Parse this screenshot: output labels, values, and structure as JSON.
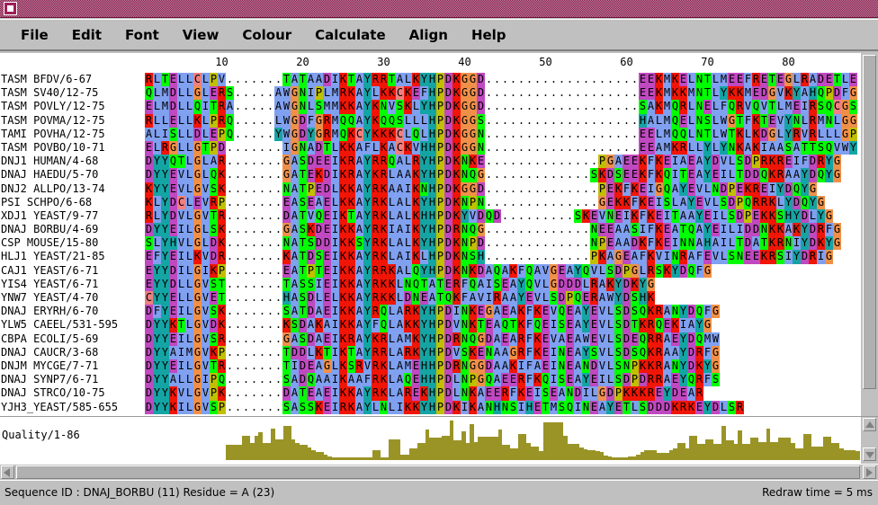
{
  "window": {
    "title": "",
    "title_button_icon": "window-menu-icon"
  },
  "menubar": {
    "items": [
      {
        "label": "File"
      },
      {
        "label": "Edit"
      },
      {
        "label": "Font"
      },
      {
        "label": "View"
      },
      {
        "label": "Colour"
      },
      {
        "label": "Calculate"
      },
      {
        "label": "Align"
      },
      {
        "label": "Help"
      }
    ]
  },
  "ruler": {
    "ticks": [
      10,
      20,
      30,
      40,
      50,
      60,
      70,
      80
    ]
  },
  "colours": {
    "A": "#80a0f0",
    "R": "#f01505",
    "N": "#00ff00",
    "D": "#c048c0",
    "C": "#f08080",
    "Q": "#00ff00",
    "E": "#c048c0",
    "G": "#f09048",
    "H": "#15a4a4",
    "I": "#80a0f0",
    "L": "#80a0f0",
    "K": "#f01505",
    "M": "#80a0f0",
    "F": "#80a0f0",
    "P": "#c0c000",
    "S": "#00ff00",
    "T": "#00ff00",
    "W": "#80a0f0",
    "Y": "#15a4a4",
    "V": "#80a0f0",
    "B": "#ffffff",
    "Z": "#ffffff",
    "X": "#ffffff",
    "-": "#ffffff",
    ".": "#ffffff",
    "gap": "#ffffff",
    "quality_bar": "#9a9427",
    "titlebar": "#8d1b4d",
    "chrome": "#c0c0c0"
  },
  "alignment": {
    "id_label_width_chars": 20,
    "sequences": [
      {
        "id": "TASM BFDV/6-67",
        "seq": "RLTELLCLPV.......TATAADIKTAYRRTALKYHPDKGGD...................EEKMKELNTLMEEFRETEGLRADETLE"
      },
      {
        "id": "TASM SV40/12-75",
        "seq": "QLMDLLGLERS.....AWGNIPLMRKAYLKKCKEFHPDKGGD...................EEKMKKMNTLYKKMEDGVKYAHQPDFG"
      },
      {
        "id": "TASM POVLY/12-75",
        "seq": "ELMDLLQITRA.....AWGNLSMMKKAYKNVSKLYHPDKGGD...................SAKMQRLNELFQRVQVTLMEIRSQCGS"
      },
      {
        "id": "TASM POVMA/12-75",
        "seq": "RLLELLKLPRQ.....LWGDFGRMQQAYKQQSLLLHPDKGGS...................HALMQELNSLWGTFKTEVYNLRMNLGG"
      },
      {
        "id": "TAMI POVHA/12-75",
        "seq": "ALISLLDLEPQ.....YWGDYGRMQKCYKKKCLQLHPDKGGN...................EELMQQLNTLWTKLKDGLYRVRLLLGP"
      },
      {
        "id": "TASM POVBO/10-71",
        "seq": "ELRGLLGTPD.......IGNADTLKKAFLKACKVHHPDKGGN...................EEAMKRLLYLYNKAKIAASATTSQVWY"
      },
      {
        "id": "DNJ1 HUMAN/4-68",
        "seq": "DYYQTLGLAR.......GASDEEIKRAYRRQALRYHPDKNKE..............PGAEEKFKEIAEAYDVLSDPRKREIFDRYG"
      },
      {
        "id": "DNAJ HAEDU/5-70",
        "seq": "DYYEVLGLQK.......GATEKDIKRAYKRLAAKYHPDKNQG.............SKDSEEKFKQITEAYEILTDDQKRAAYDQYG"
      },
      {
        "id": "DNJ2 ALLPO/13-74",
        "seq": "KYYEVLGVSK.......NATPEDLKKAYRKAAIKNHPDKGGD..............PEKFKEIGQAYEVLNDPEKREIYDQYG"
      },
      {
        "id": "PSI SCHPO/6-68",
        "seq": "KLYDCLEVRP.......EASEAELKKAYRKLALKYHPDKNPN..............GEKKFKEISLAYEVLSDPQRRKLYDQYG"
      },
      {
        "id": "XDJ1 YEAST/9-77",
        "seq": "RLYDVLGVTR.......DATVQEIKTAYRKLALKHHPDKYVDQD.........SKEVNEIKFKEITAAYEILSDPEKKSHYDLYG"
      },
      {
        "id": "DNAJ BORBU/4-69",
        "seq": "DYYEILGLSK.......GASKDEIKKAYRKIAIKYHPDRNQG.............NEEAASIFKEATQAYEILIDDNKKAKYDRFG"
      },
      {
        "id": "CSP MOUSE/15-80",
        "seq": "SLYHVLGLDK.......NATSDDIKKSYRKLALKYHPDKNPD.............NPEAADKFKEINNAHAILTDATKRNIYDKYG"
      },
      {
        "id": "HLJ1 YEAST/21-85",
        "seq": "EFYEILKVDR.......KATDSEIKKAYRKLAIKLHPDKNSH.............PKAGEAFKVINRAFEVLSNEEKRSIYDRIG"
      },
      {
        "id": "CAJ1 YEAST/6-71",
        "seq": "EYYDILGIKP.......EATPTEIKKAYRRKALQYHPDKNKDAQAKFQAVGEAYQVLSDPGLRSKYDQFG"
      },
      {
        "id": "YIS4 YEAST/6-71",
        "seq": "EYYDLLGVST.......TASSIEIKKAYRKKLNQTATERFQAISEAYQVLGDDDLRAKYDKYG"
      },
      {
        "id": "YNW7 YEAST/4-70",
        "seq": "CYYELLGVET.......HASDLELKKAYRKKLDNEATQKFAVIRAAYEVLSDPQERAWYDSHK"
      },
      {
        "id": "DNAJ ERYRH/6-70",
        "seq": "DFYEILGVSK.......SATDAEIKKAYRQLARKYHPDINKEGAEAKFKEVQEAYEVLSDSQKRANYDQFG"
      },
      {
        "id": "YLW5 CAEEL/531-595",
        "seq": "DYYKTLGVDK.......KSDAKAIKKAYFQLAKKYHPDVNKTEAQTKFQEISEAYEVLSDTKRQEKIAYG"
      },
      {
        "id": "CBPA ECOLI/5-69",
        "seq": "DYYEILGVSR.......GASDAEIKRAYKRLAMKYHPDRNQGDAEARFKEVAEAWEVLSDEQRRAEYDQMW"
      },
      {
        "id": "DNAJ CAUCR/3-68",
        "seq": "DYYAIMGVKP.......TDDLKTIKTAYRRLARKYHPDVSKENAAGRFKEINEAYSVLSDSQKRAAYDRFG"
      },
      {
        "id": "DNJM MYCGE/7-71",
        "seq": "DYYEILGVTR.......TIDEAGLKSRVRKLAMEHHPDRNGGDAAKIFAEINEANDVLSNPKKRANYDKYG"
      },
      {
        "id": "DNAJ SYNP7/6-71",
        "seq": "DYYALLGIPQ.......SADQAAIKAAFRKLAQEHHPDLNPGQAEERFKQISEAYEILSDPDRRAEYQRFS"
      },
      {
        "id": "DNAJ STRCO/10-75",
        "seq": "DYYKVLGVPK.......DATEAEIKKAYRKLAREKHPDLNKAEERFKEISEANDILGDPKKKREYDEAR"
      },
      {
        "id": "YJH3_YEAST/585-655",
        "seq": "DYYKILGVSP.......SASSKEIRKAYLNLIKKYHPDKIKANHNSIHETMSQINEAYETLSDDDKRKEYDLSR"
      }
    ]
  },
  "annotation": {
    "label": "Quality/1-86",
    "bar_color": "#9a9427",
    "values": [
      0,
      0,
      0,
      0,
      0,
      0,
      0,
      0,
      0,
      0,
      0,
      0,
      0,
      0,
      0,
      0,
      0,
      0,
      0,
      0,
      0.38,
      0.38,
      0.38,
      0.38,
      0.62,
      0.62,
      0.44,
      0.62,
      0.7,
      0.44,
      0.44,
      0.8,
      0.52,
      0.52,
      0.86,
      0.86,
      0.52,
      0.44,
      0.38,
      0.38,
      0.32,
      0.26,
      0.2,
      0.2,
      0.14,
      0.1,
      0.07,
      0.07,
      0.07,
      0.07,
      0.07,
      0.07,
      0.07,
      0.07,
      0.07,
      0.07,
      0.24,
      0.24,
      0.07,
      0.07,
      0.52,
      0.52,
      0.52,
      0.14,
      0.14,
      0.3,
      0.3,
      0.44,
      0.44,
      0.78,
      0.56,
      0.56,
      0.56,
      0.62,
      0.62,
      1.0,
      0.5,
      0.5,
      0.72,
      0.44,
      0.9,
      0.46,
      0.6,
      0.6,
      0.6,
      0.6,
      0.6,
      0.78,
      0.38,
      0.38,
      0.3,
      0.3,
      0.66,
      0.66,
      0.44,
      0.34,
      0.34,
      0.22,
      0.95,
      0.95,
      0.95,
      0.95,
      0.95,
      0.62,
      0.4,
      0.4,
      0.4,
      0.32,
      0.28,
      0.26,
      0.24,
      0.22,
      0.2,
      0.12,
      0.08,
      0.06,
      0.06,
      0.06,
      0.06,
      0.08,
      0.1,
      0.14,
      0.2,
      0.24,
      0.24,
      0.24,
      0.18,
      0.18,
      0.18,
      0.24,
      0.3,
      0.44,
      0.44,
      0.3,
      0.62,
      0.62,
      0.4,
      0.4,
      0.52,
      0.52,
      0.4,
      0.4,
      0.86,
      0.5,
      0.5,
      0.4,
      0.76,
      0.42,
      0.42,
      0.56,
      0.56,
      0.46,
      0.46,
      0.8,
      0.46,
      0.46,
      0.56,
      0.56,
      0.56,
      0.44,
      0.3,
      0.3,
      0.66,
      0.66,
      0.34,
      0.34,
      0.34,
      0.58,
      0.58,
      0.44,
      0.44,
      0.3,
      0.24,
      0.24,
      0.24,
      0.22
    ]
  },
  "statusbar": {
    "left_text": "Sequence ID : DNAJ_BORBU (11) Residue = A (23)",
    "right_text": "Redraw time = 5 ms"
  },
  "scrollbars": {
    "vertical_up_icon": "arrow-up-icon",
    "vertical_down_icon": "arrow-down-icon",
    "horizontal_left_icon": "arrow-left-icon",
    "horizontal_right_icon": "arrow-right-icon"
  }
}
